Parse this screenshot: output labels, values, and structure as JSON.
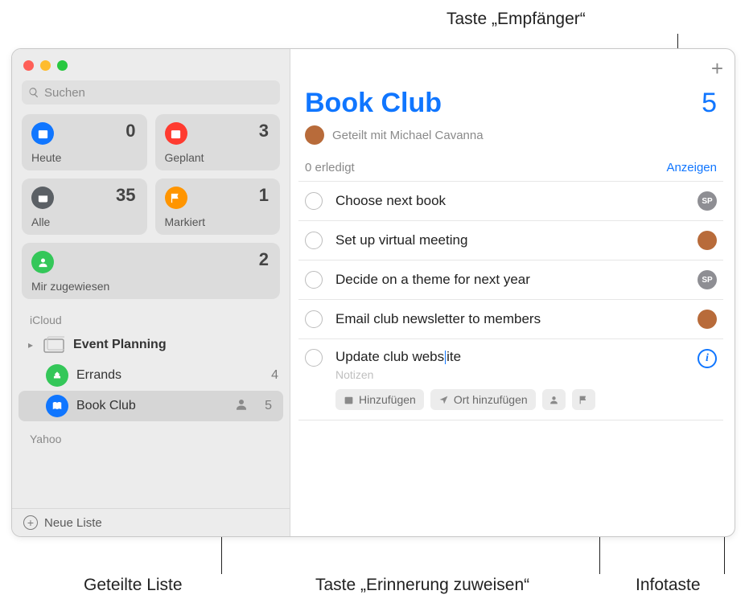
{
  "callouts": {
    "recipients": "Taste „Empfänger“",
    "sharedList": "Geteilte Liste",
    "assign": "Taste „Erinnerung zuweisen“",
    "info": "Infotaste"
  },
  "search": {
    "placeholder": "Suchen"
  },
  "smart": {
    "today": {
      "label": "Heute",
      "count": "0",
      "color": "#1076ff"
    },
    "scheduled": {
      "label": "Geplant",
      "count": "3",
      "color": "#ff3b30"
    },
    "all": {
      "label": "Alle",
      "count": "35",
      "color": "#5b6065"
    },
    "flagged": {
      "label": "Markiert",
      "count": "1",
      "color": "#ff9500"
    },
    "assigned": {
      "label": "Mir zugewiesen",
      "count": "2",
      "color": "#34c759"
    }
  },
  "sections": {
    "icloud": "iCloud",
    "yahoo": "Yahoo"
  },
  "lists": {
    "eventPlanning": {
      "label": "Event Planning",
      "count": ""
    },
    "errands": {
      "label": "Errands",
      "count": "4",
      "color": "#34c759"
    },
    "bookClub": {
      "label": "Book Club",
      "count": "5",
      "color": "#1076ff"
    }
  },
  "footer": {
    "newList": "Neue Liste"
  },
  "main": {
    "title": "Book Club",
    "count": "5",
    "shared": "Geteilt mit Michael Cavanna",
    "done": "0 erledigt",
    "show": "Anzeigen"
  },
  "reminders": [
    {
      "text": "Choose next book",
      "badge": "SP",
      "badgeType": "sp"
    },
    {
      "text": "Set up virtual meeting",
      "badge": "",
      "badgeType": "av"
    },
    {
      "text": "Decide on a theme for next year",
      "badge": "SP",
      "badgeType": "sp"
    },
    {
      "text": "Email club newsletter to members",
      "badge": "",
      "badgeType": "av"
    }
  ],
  "editing": {
    "before": "Update club webs",
    "after": "ite",
    "notes": "Notizen",
    "addDate": "Hinzufügen",
    "addLoc": "Ort hinzufügen"
  }
}
